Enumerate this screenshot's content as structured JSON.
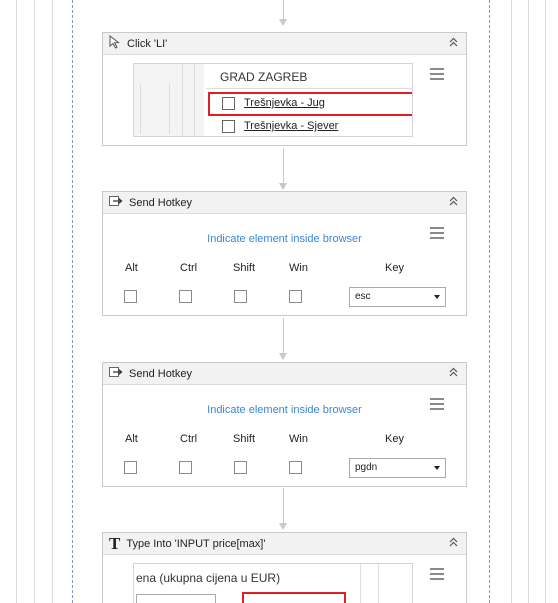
{
  "click_activity": {
    "title": "Click 'LI'",
    "collapse_glyph": "⌃",
    "heading": "GRAD ZAGREB",
    "items": [
      {
        "label": "Trešnjevka - Jug",
        "selected": true
      },
      {
        "label": "Trešnjevka - Sjever",
        "selected": false
      }
    ]
  },
  "hotkey1": {
    "title": "Send Hotkey",
    "indicate": "Indicate element inside browser",
    "labels": {
      "alt": "Alt",
      "ctrl": "Ctrl",
      "shift": "Shift",
      "win": "Win",
      "key": "Key"
    },
    "key_value": "esc"
  },
  "hotkey2": {
    "title": "Send Hotkey",
    "indicate": "Indicate element inside browser",
    "labels": {
      "alt": "Alt",
      "ctrl": "Ctrl",
      "shift": "Shift",
      "win": "Win",
      "key": "Key"
    },
    "key_value": "pgdn"
  },
  "type_activity": {
    "title": "Type Into 'INPUT  price[max]'",
    "icon_glyph": "T",
    "preview_text": "ena (ukupna cijena u EUR)"
  },
  "colors": {
    "highlight": "#e02020",
    "link": "#3a87d6",
    "border": "#c9c9c9"
  }
}
